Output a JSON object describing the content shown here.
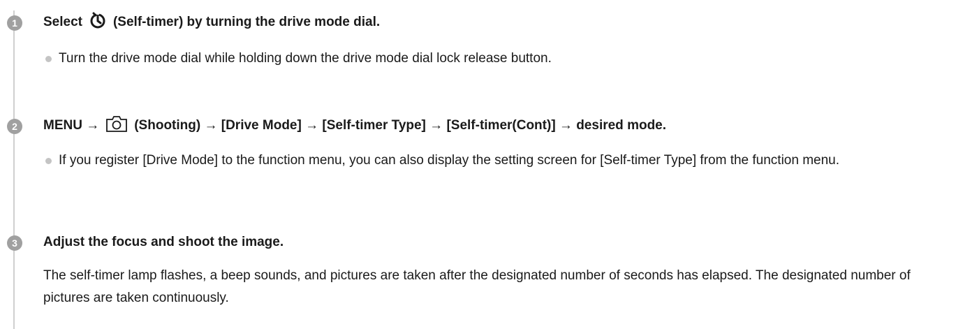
{
  "steps": [
    {
      "number": "1",
      "heading_before": "Select",
      "heading_after": "(Self-timer) by turning the drive mode dial.",
      "icon": "self-timer-icon",
      "bullets": [
        "Turn the drive mode dial while holding down the drive mode dial lock release button."
      ]
    },
    {
      "number": "2",
      "heading_before": "MENU →",
      "heading_after": "(Shooting) → [Drive Mode] → [Self-timer Type] → [Self-timer(Cont)] → desired mode.",
      "icon": "camera-shooting-icon",
      "bullets": [
        "If you register [Drive Mode] to the function menu, you can also display the setting screen for [Self-timer Type] from the function menu."
      ]
    },
    {
      "number": "3",
      "heading": "Adjust the focus and shoot the image.",
      "paragraph": "The self-timer lamp flashes, a beep sounds, and pictures are taken after the designated number of seconds has elapsed. The designated number of pictures are taken continuously."
    }
  ]
}
